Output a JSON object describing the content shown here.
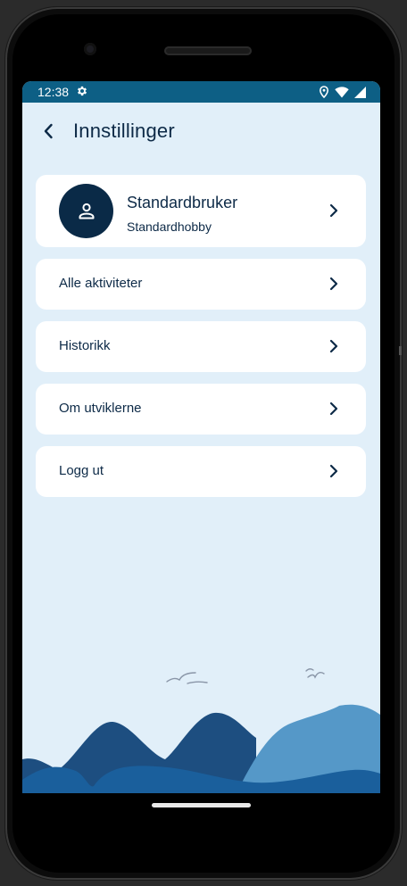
{
  "statusbar": {
    "time": "12:38"
  },
  "appbar": {
    "title": "Innstillinger"
  },
  "profile": {
    "name": "Standardbruker",
    "hobby": "Standardhobby"
  },
  "menu": [
    {
      "label": "Alle aktiviteter"
    },
    {
      "label": "Historikk"
    },
    {
      "label": "Om utviklerne"
    },
    {
      "label": "Logg ut"
    }
  ],
  "colors": {
    "statusbar": "#0d5f85",
    "background": "#e1eff9",
    "primary_text": "#0d2a47",
    "avatar": "#0a2a47",
    "mountain_dark": "#1d4e80",
    "mountain_light": "#5598c8",
    "water": "#1a5f9c"
  }
}
